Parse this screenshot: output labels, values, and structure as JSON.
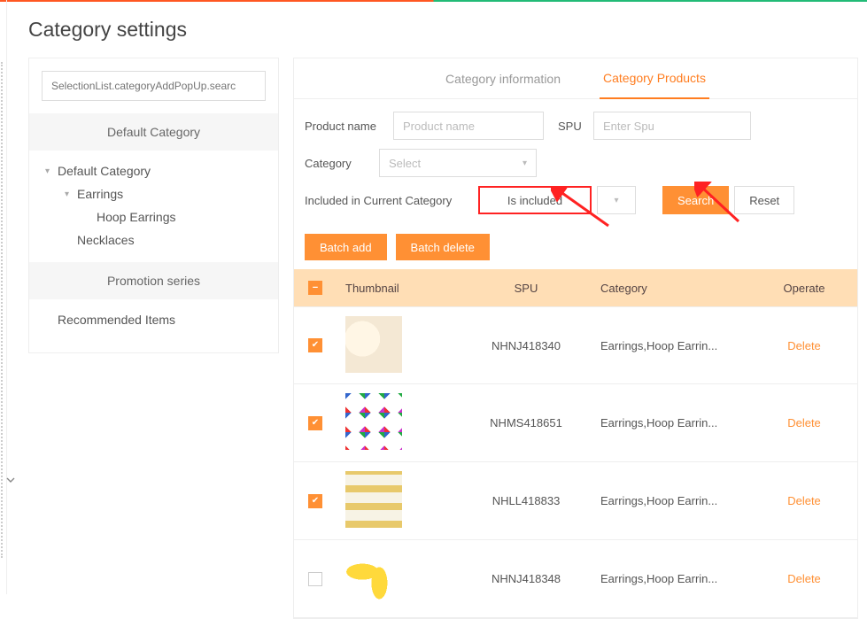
{
  "page_title": "Category settings",
  "sidebar": {
    "search_placeholder": "SelectionList.categoryAddPopUp.searc",
    "blocks": {
      "default": "Default Category",
      "promotion": "Promotion series"
    },
    "tree": {
      "root": "Default Category",
      "children": [
        {
          "label": "Earrings",
          "children": [
            {
              "label": "Hoop Earrings"
            }
          ]
        },
        {
          "label": "Necklaces"
        }
      ]
    },
    "recommended": "Recommended Items"
  },
  "tabs": {
    "info": "Category information",
    "products": "Category Products"
  },
  "filters": {
    "product_name_label": "Product name",
    "product_name_placeholder": "Product name",
    "spu_label": "SPU",
    "spu_placeholder": "Enter Spu",
    "category_label": "Category",
    "category_placeholder": "Select",
    "included_label": "Included in Current Category",
    "included_value": "Is included",
    "search_btn": "Search",
    "reset_btn": "Reset"
  },
  "batch": {
    "add": "Batch add",
    "delete": "Batch delete"
  },
  "table": {
    "headers": {
      "thumbnail": "Thumbnail",
      "spu": "SPU",
      "category": "Category",
      "operate": "Operate"
    },
    "rows": [
      {
        "checked": true,
        "thumb": "t1",
        "spu": "NHNJ418340",
        "category": "Earrings,Hoop Earrin...",
        "op": "Delete"
      },
      {
        "checked": true,
        "thumb": "t2",
        "spu": "NHMS418651",
        "category": "Earrings,Hoop Earrin...",
        "op": "Delete"
      },
      {
        "checked": true,
        "thumb": "t3",
        "spu": "NHLL418833",
        "category": "Earrings,Hoop Earrin...",
        "op": "Delete"
      },
      {
        "checked": false,
        "thumb": "t4",
        "spu": "NHNJ418348",
        "category": "Earrings,Hoop Earrin...",
        "op": "Delete"
      }
    ]
  }
}
